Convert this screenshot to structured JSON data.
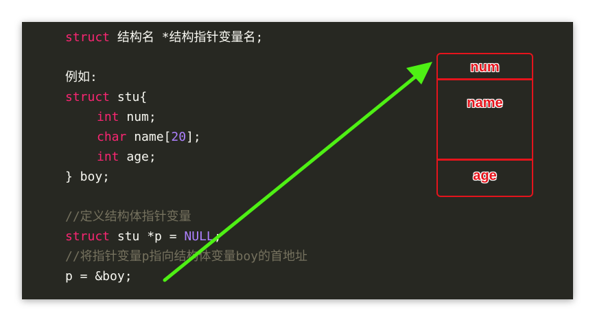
{
  "code": {
    "line1": {
      "kw": "struct",
      "rest": " 结构名 *结构指针变量名;"
    },
    "line3": "例如:",
    "line4": {
      "kw": "struct",
      "rest": " stu{"
    },
    "line5": {
      "type": "int",
      "rest": " num;"
    },
    "line6": {
      "type": "char",
      "rest_a": " name[",
      "number": "20",
      "rest_b": "];"
    },
    "line7": {
      "type": "int",
      "rest": " age;"
    },
    "line8": "} boy;",
    "line10": "//定义结构体指针变量",
    "line11": {
      "kw": "struct",
      "mid": " stu *p = ",
      "const": "NULL",
      "end": ";"
    },
    "line12": "//将指针变量p指向结构体变量boy的首地址",
    "line13": "p = &boy;"
  },
  "memory": {
    "fields": [
      "num",
      "name",
      "age"
    ]
  },
  "colors": {
    "background": "#272822",
    "keyword": "#f92672",
    "number": "#ae81ff",
    "comment": "#75715e",
    "text": "#f8f8f2",
    "box_red": "#e5141c",
    "arrow_green": "#4ef014"
  }
}
